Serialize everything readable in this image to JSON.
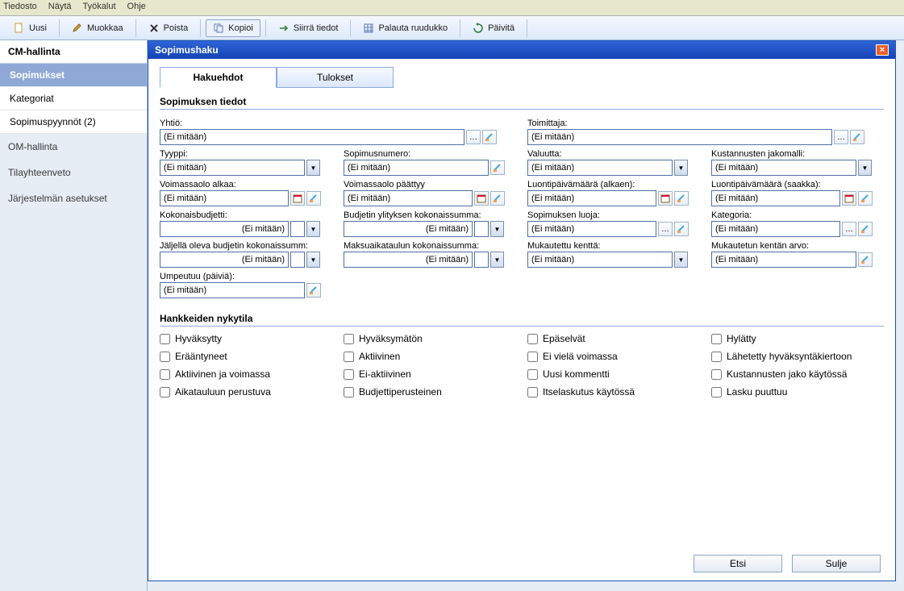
{
  "menu": [
    "Tiedosto",
    "Näytä",
    "Työkalut",
    "Ohje"
  ],
  "toolbar": {
    "uusi": "Uusi",
    "muokkaa": "Muokkaa",
    "poista": "Poista",
    "kopioi": "Kopioi",
    "siirra": "Siirrä tiedot",
    "palauta": "Palauta ruudukko",
    "paivita": "Päivitä"
  },
  "sidebar": {
    "group_title": "CM-hallinta",
    "items": [
      "Sopimukset",
      "Kategoriat",
      "Sopimuspyynnöt (2)"
    ],
    "sections": [
      "OM-hallinta",
      "Tilayhteenveto",
      "Järjestelmän asetukset"
    ]
  },
  "dialog": {
    "title": "Sopimushaku",
    "tabs": [
      "Hakuehdot",
      "Tulokset"
    ],
    "section1": "Sopimuksen tiedot",
    "section2": "Hankkeiden nykytila",
    "ei_mitaan": "(Ei mitään)",
    "labels": {
      "yhtio": "Yhtiö:",
      "toimittaja": "Toimittaja:",
      "tyyppi": "Tyyppi:",
      "sopimusnumero": "Sopimusnumero:",
      "valuutta": "Valuutta:",
      "kustannusten_jakomalli": "Kustannusten jakomalli:",
      "voimassa_alkaa": "Voimassaolo alkaa:",
      "voimassa_paattyy": "Voimassaolo päättyy",
      "luontipvm_alkaen": "Luontipäivämäärä (alkaen):",
      "luontipvm_saakka": "Luontipäivämäärä (saakka):",
      "kokonaisbudjetti": "Kokonaisbudjetti:",
      "budjetin_ylitys": "Budjetin ylityksen kokonaissumma:",
      "sopimuksen_luoja": "Sopimuksen luoja:",
      "kategoria": "Kategoria:",
      "jaljella_budjetti": "Jäljellä oleva budjetin kokonaissumm:",
      "maksuaikataulu": "Maksuaikataulun kokonaissumma:",
      "mukautettu_kentta": "Mukautettu kenttä:",
      "mukautetun_arvo": "Mukautetun kentän arvo:",
      "umpeutuu": "Umpeutuu (päiviä):"
    },
    "checks": {
      "hyvaksytty": "Hyväksytty",
      "hyvaksymaton": "Hyväksymätön",
      "epaselvat": "Epäselvät",
      "hylatty": "Hylätty",
      "eraantyneet": "Erääntyneet",
      "aktiivinen": "Aktiivinen",
      "ei_viela": "Ei vielä voimassa",
      "lahetetty": "Lähetetty hyväksyntäkiertoon",
      "akt_voimassa": "Aktiivinen ja voimassa",
      "ei_aktiivinen": "Ei-aktiivinen",
      "uusi_kommentti": "Uusi kommentti",
      "kust_jako": "Kustannusten jako käytössä",
      "aikatauluun": "Aikatauluun perustuva",
      "budjettiper": "Budjettiperusteinen",
      "itselaskutus": "Itselaskutus käytössä",
      "lasku_puuttuu": "Lasku puuttuu"
    },
    "buttons": {
      "etsi": "Etsi",
      "sulje": "Sulje"
    }
  }
}
